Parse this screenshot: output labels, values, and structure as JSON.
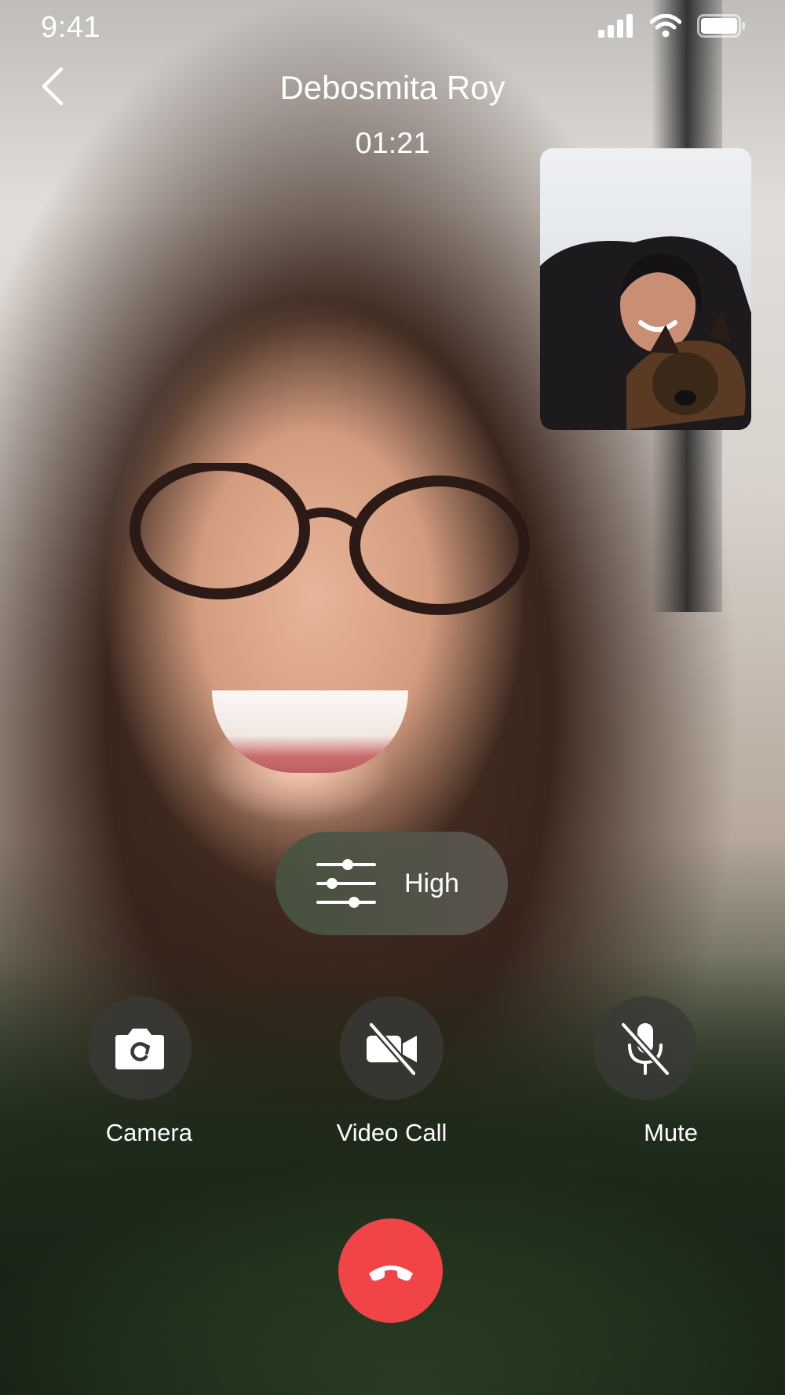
{
  "status_bar": {
    "time": "9:41",
    "icons": [
      "signal-icon",
      "wifi-icon",
      "battery-icon"
    ]
  },
  "call": {
    "caller_name": "Debosmita Roy",
    "duration": "01:21"
  },
  "quality": {
    "label": "High"
  },
  "controls": {
    "camera_label": "Camera",
    "video_label": "Video Call",
    "mute_label": "Mute"
  },
  "colors": {
    "end_call": "#f04447",
    "control_bg": "#3a3a37",
    "text": "#ffffff"
  }
}
